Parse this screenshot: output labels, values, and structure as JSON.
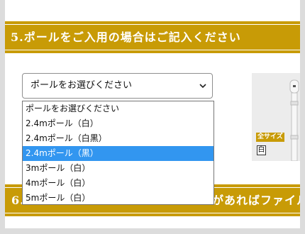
{
  "section5": {
    "title": "5.ポールをご入用の場合はご記入ください"
  },
  "section6": {
    "title_prefix": "6.",
    "title_suffix": "があればファイル"
  },
  "pole_select": {
    "selected_value": "ポールをお選びください",
    "options": [
      "ポールをお選びください",
      "2.4mポール（白）",
      "2.4mポール（白黒）",
      "2.4mポール（黒）",
      "3mポール（白）",
      "4mポール（白）",
      "5mポール（白）"
    ],
    "highlighted_index": 3
  },
  "product_image": {
    "badge": "全サイズ",
    "color_label": "白"
  },
  "colors": {
    "band": "#c89b06",
    "highlight": "#3296f0"
  },
  "icons": {
    "select_arrow": "chevron-down-icon"
  }
}
